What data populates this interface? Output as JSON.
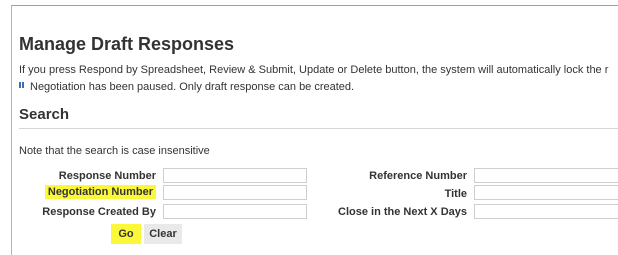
{
  "header": {
    "title": "Manage Draft Responses",
    "info": "If you press Respond by Spreadsheet, Review & Submit, Update or Delete button, the system will automatically lock the r",
    "pause_message": "Negotiation has been paused. Only draft response can be created."
  },
  "search": {
    "title": "Search",
    "note": "Note that the search is case insensitive",
    "fields": {
      "response_number": {
        "label": "Response Number",
        "value": ""
      },
      "negotiation_number": {
        "label": "Negotiation Number",
        "value": ""
      },
      "response_created_by": {
        "label": "Response Created By",
        "value": ""
      },
      "reference_number": {
        "label": "Reference Number",
        "value": ""
      },
      "title": {
        "label": "Title",
        "value": ""
      },
      "close_days": {
        "label": "Close in the Next X Days",
        "value": ""
      }
    },
    "go_label": "Go",
    "clear_label": "Clear"
  },
  "colors": {
    "highlight": "#fbf83a",
    "pause_icon": "#3d6fb3",
    "clear_button": "#e9e9e9"
  }
}
